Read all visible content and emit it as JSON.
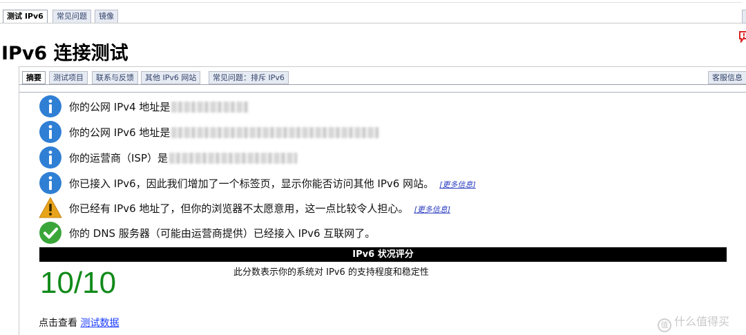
{
  "top_tabs": [
    {
      "label": "测试 IPv6",
      "active": true
    },
    {
      "label": "常见问题",
      "active": false
    },
    {
      "label": "镜像",
      "active": false
    }
  ],
  "page_title": "IPv6 连接测试",
  "inner_tabs": [
    {
      "label": "摘要",
      "active": true
    },
    {
      "label": "测试项目",
      "active": false
    },
    {
      "label": "联系与反馈",
      "active": false
    },
    {
      "label": "其他 IPv6 网站",
      "active": false
    },
    {
      "label": "常见问题：排斥 IPv6",
      "active": false
    }
  ],
  "support_tab": "客服信息",
  "results": [
    {
      "icon": "info-icon",
      "text": "你的公网 IPv4 地址是"
    },
    {
      "icon": "info-icon",
      "text": "你的公网 IPv6 地址是"
    },
    {
      "icon": "info-icon",
      "text": "你的运营商（ISP）是"
    },
    {
      "icon": "info-icon",
      "text": "你已接入 IPv6，因此我们增加了一个标签页，显示你能否访问其他 IPv6 网站。",
      "link": "[更多信息]"
    },
    {
      "icon": "warning-icon",
      "text": "你已经有 IPv6 地址了，但你的浏览器不太愿意用，这一点比较令人担心。",
      "link": "[更多信息]"
    },
    {
      "icon": "check-icon",
      "text": "你的 DNS 服务器（可能由运营商提供）已经接入 IPv6 互联网了。"
    }
  ],
  "score": {
    "header": "IPv6 状况评分",
    "value": "10/10",
    "description": "此分数表示你的系统对 IPv6 的支持程度和稳定性"
  },
  "view_data": {
    "prefix": "点击查看 ",
    "link": "测试数据"
  },
  "watermark": "什么值得买",
  "colors": {
    "info": "#2f7fd4",
    "warning": "#e8a41a",
    "check": "#3aa63a",
    "score": "#118a1a",
    "link": "#1a3cff"
  }
}
